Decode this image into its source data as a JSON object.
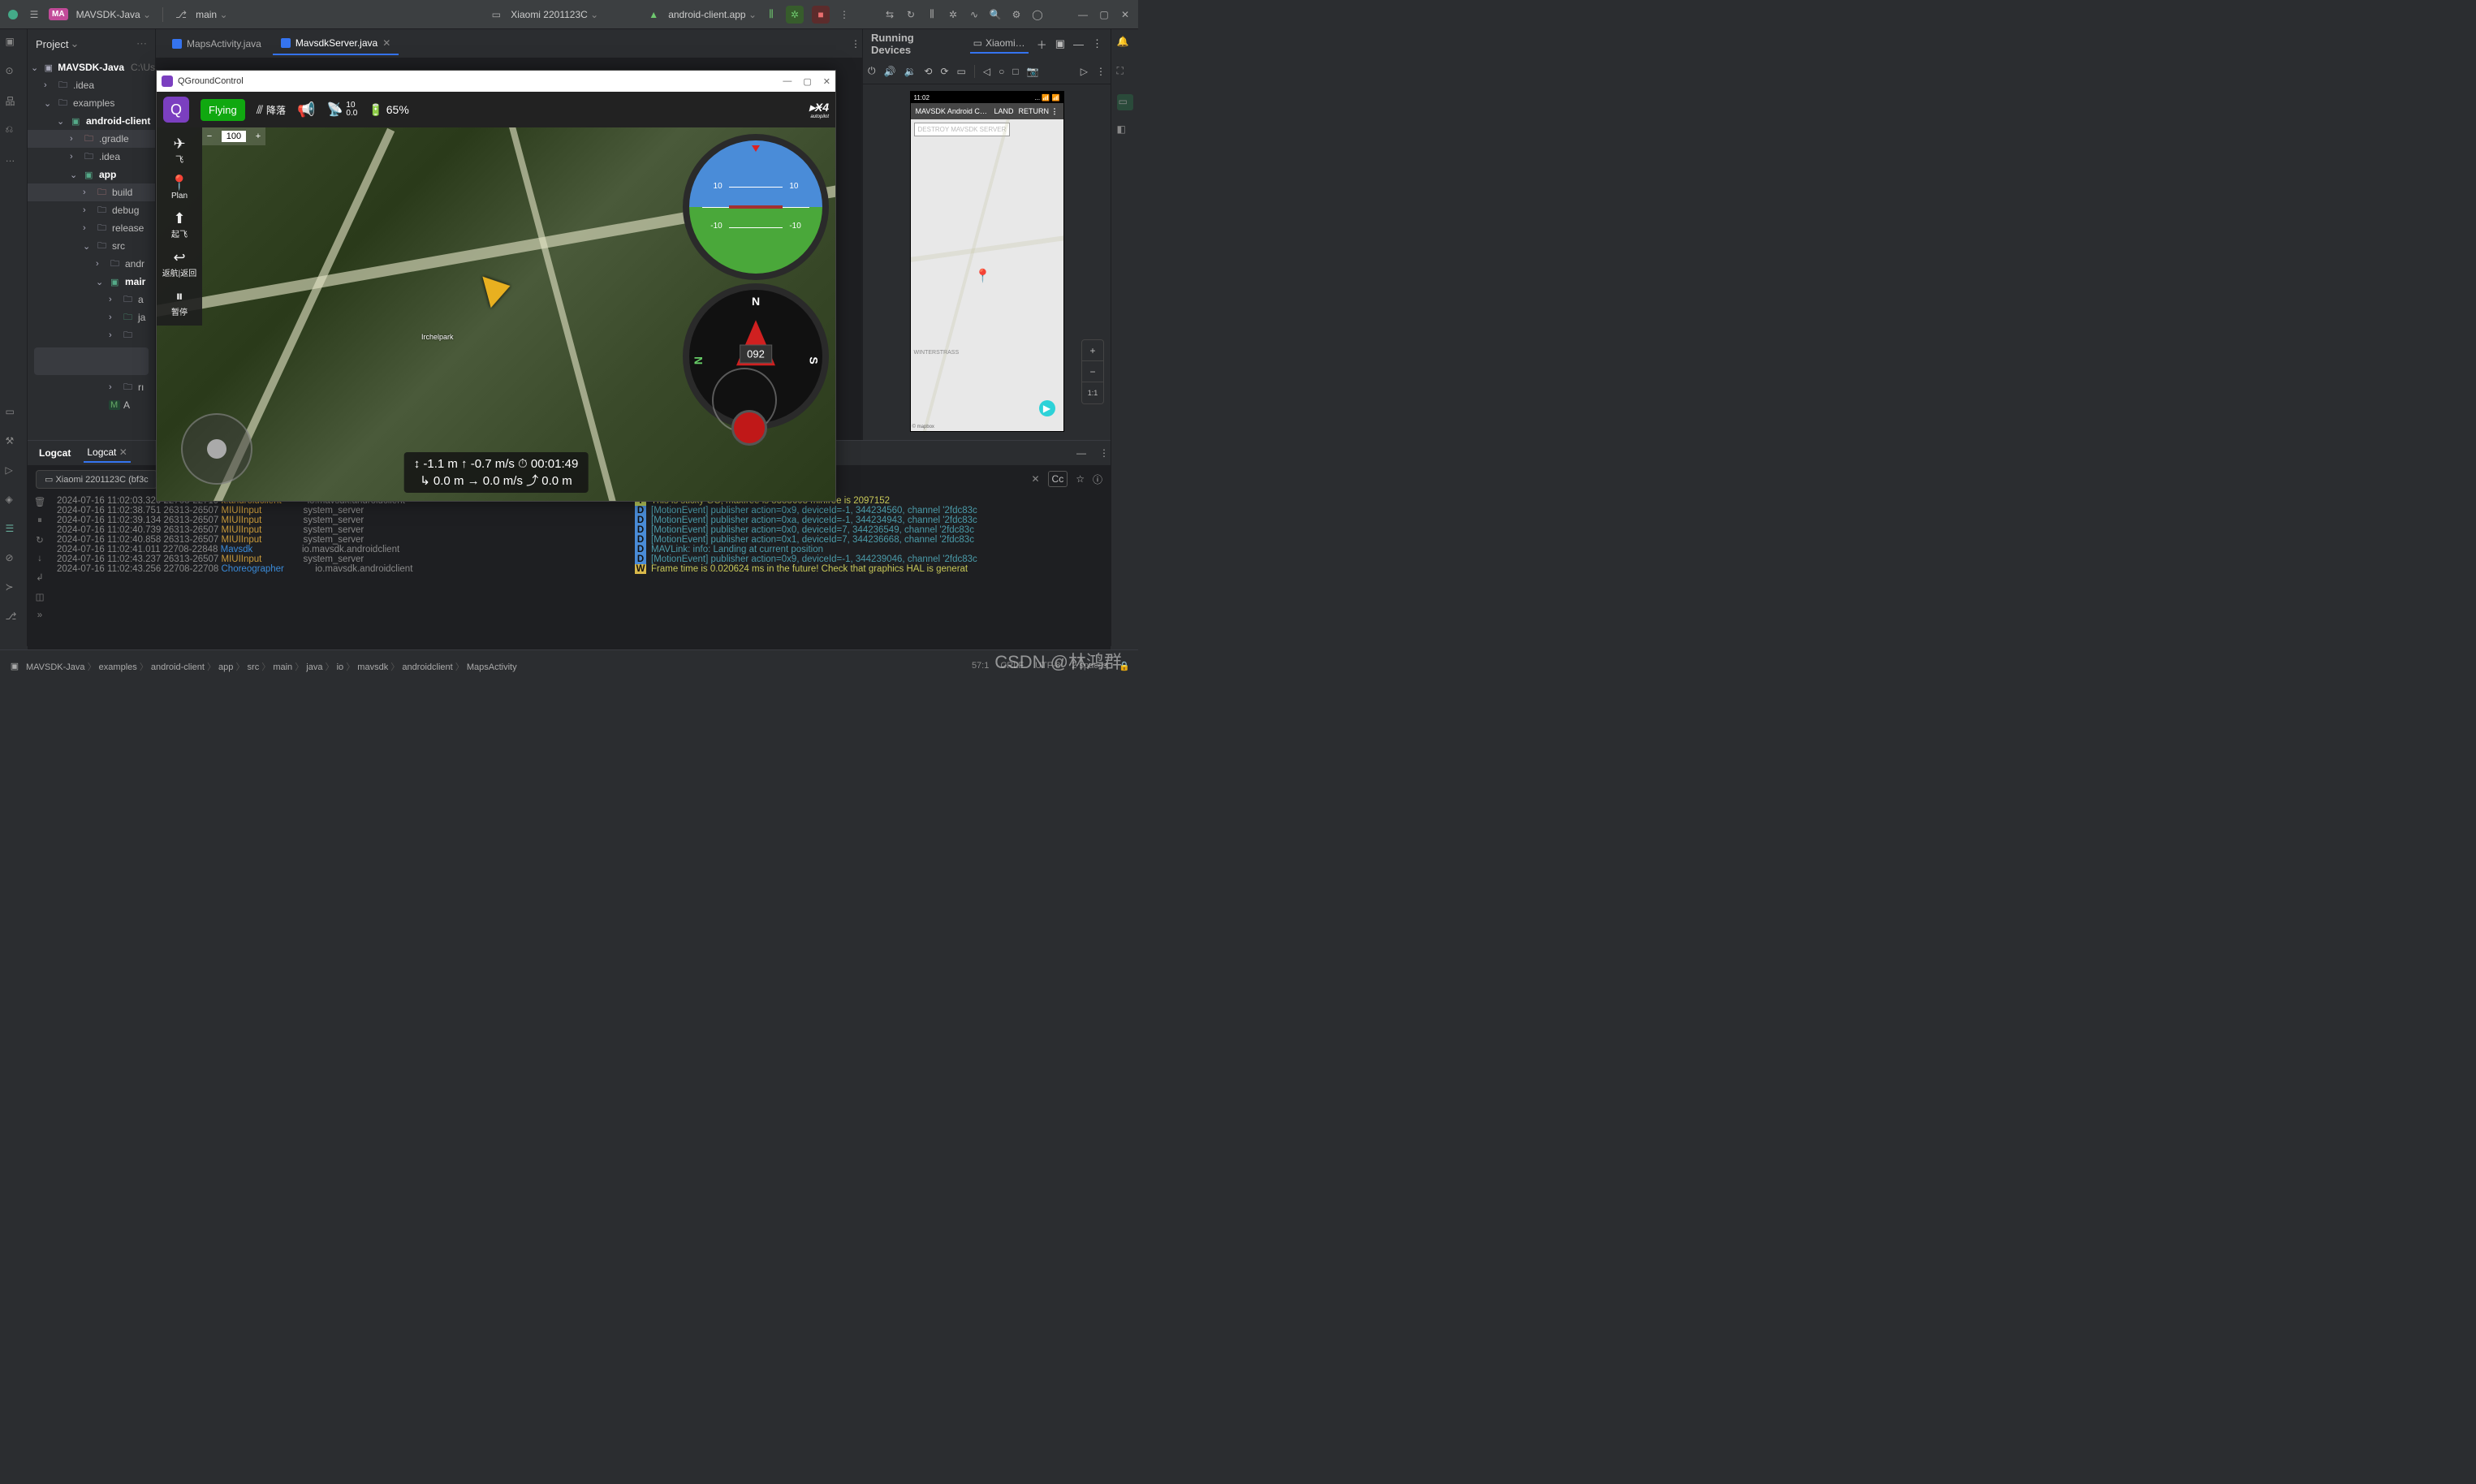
{
  "titlebar": {
    "project_badge": "MA",
    "project_name": "MAVSDK-Java",
    "branch": "main",
    "device": "Xiaomi 2201123C",
    "run_config": "android-client.app"
  },
  "project_panel": {
    "title": "Project",
    "tree": {
      "root": "MAVSDK-Java",
      "root_hint": "C:\\Us",
      "idea": ".idea",
      "examples": "examples",
      "android_client": "android-client",
      "gradle": ".gradle",
      "idea2": ".idea",
      "app": "app",
      "build": "build",
      "debug": "debug",
      "release": "release",
      "src": "src",
      "andr": "andr",
      "main": "mair",
      "a_item": "a",
      "j_item": "ja",
      "r_item": "rı",
      "A_file": "A",
      "scratches_hint": "…"
    }
  },
  "tabs": {
    "t1": "MapsActivity.java",
    "t2": "MavsdkServer.java"
  },
  "running": {
    "title": "Running Devices",
    "tab": "Xiaomi…"
  },
  "phone": {
    "time": "11:02",
    "net": "... 📶 📶",
    "app_title": "MAVSDK Android C…",
    "land": "LAND",
    "return": "RETURN",
    "destroy": "DESTROY MAVSDK SERVER",
    "map_credit": "© mapbox",
    "label1": "WINTERSTRASS"
  },
  "zoom_ctl": {
    "plus": "+",
    "minus": "−",
    "ratio": "1:1"
  },
  "qgc": {
    "wtitle": "QGroundControl",
    "fly": "Flying",
    "land_cn": "降落",
    "s1": "10",
    "s2": "0.0",
    "batt": "65%",
    "plan": "Plan",
    "takeoff": "起飞",
    "rtl": "返航|返回",
    "pause": "暂停",
    "zoom_minus": "−",
    "zoom_val": "100",
    "zoom_plus": "+",
    "heading": "092",
    "adi_p10a": "10",
    "adi_p10b": "10",
    "adi_m10a": "-10",
    "adi_m10b": "-10",
    "card_n": "N",
    "card_s": "S",
    "telem1": "↕ -1.1 m   ↑ -0.7 m/s   ⏱ 00:01:49",
    "telem2": "↳ 0.0 m   → 0.0 m/s   ⤴ 0.0 m",
    "px4": "PX4 autopilot",
    "map_lbl_irchel": "Irchelpark"
  },
  "bottom": {
    "panel_title": "Logcat",
    "tab": "Logcat",
    "device": "Xiaomi 2201123C (bf3c",
    "cc": "Cc"
  },
  "logs": [
    {
      "ts": "2024-07-16 11:02:03.320 22708-22719",
      "tag": "k.androidclient",
      "tagc": "g",
      "proc": "io.mavsdk.androidclient",
      "lvl": "I",
      "msg": "This is sticky GC, maxfree is 8388608 minfree is 2097152",
      "mc": "y"
    },
    {
      "ts": "2024-07-16 11:02:38.751 26313-26507",
      "tag": "MIUIInput",
      "tagc": "g",
      "proc": "system_server",
      "lvl": "D",
      "msg": "[MotionEvent] publisher action=0x9, deviceId=-1, 344234560, channel '2fdc83c",
      "mc": "b"
    },
    {
      "ts": "2024-07-16 11:02:39.134 26313-26507",
      "tag": "MIUIInput",
      "tagc": "g",
      "proc": "system_server",
      "lvl": "D",
      "msg": "[MotionEvent] publisher action=0xa, deviceId=-1, 344234943, channel '2fdc83c",
      "mc": "b"
    },
    {
      "ts": "2024-07-16 11:02:40.739 26313-26507",
      "tag": "MIUIInput",
      "tagc": "g",
      "proc": "system_server",
      "lvl": "D",
      "msg": "[MotionEvent] publisher action=0x0, deviceId=7, 344236549, channel '2fdc83c",
      "mc": "b"
    },
    {
      "ts": "2024-07-16 11:02:40.858 26313-26507",
      "tag": "MIUIInput",
      "tagc": "g",
      "proc": "system_server",
      "lvl": "D",
      "msg": "[MotionEvent] publisher action=0x1, deviceId=7, 344236668, channel '2fdc83c",
      "mc": "b"
    },
    {
      "ts": "2024-07-16 11:02:41.011 22708-22848",
      "tag": "Mavsdk",
      "tagc": "b",
      "proc": "io.mavsdk.androidclient",
      "lvl": "D",
      "msg": "MAVLink: info: Landing at current position",
      "mc": "b"
    },
    {
      "ts": "2024-07-16 11:02:43.237 26313-26507",
      "tag": "MIUIInput",
      "tagc": "g",
      "proc": "system_server",
      "lvl": "D",
      "msg": "[MotionEvent] publisher action=0x9, deviceId=-1, 344239046, channel '2fdc83c",
      "mc": "b"
    },
    {
      "ts": "2024-07-16 11:02:43.256 22708-22708",
      "tag": "Choreographer",
      "tagc": "b",
      "proc": "io.mavsdk.androidclient",
      "lvl": "W",
      "msg": "Frame time is 0.020624 ms in the future!  Check that graphics HAL is generat",
      "mc": "y"
    }
  ],
  "breadcrumbs": [
    "MAVSDK-Java",
    "examples",
    "android-client",
    "app",
    "src",
    "main",
    "java",
    "io",
    "mavsdk",
    "androidclient",
    "MapsActivity"
  ],
  "status": {
    "pos": "57:1",
    "crlf": "CRLF",
    "enc": "UTF-8",
    "indent": "2 spaces"
  },
  "watermark": "CSDN @林鸿群"
}
